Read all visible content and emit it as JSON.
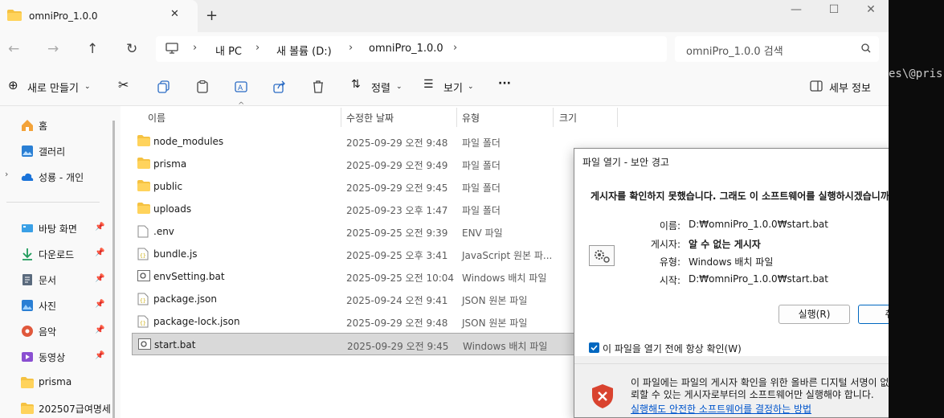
{
  "window": {
    "tab_title": "omniPro_1.0.0",
    "new_tab": "+",
    "close_tab": "✕",
    "minimize": "—",
    "maximize": "☐",
    "close": "✕"
  },
  "address": {
    "crumbs": [
      "내 PC",
      "새 볼륨 (D:)",
      "omniPro_1.0.0"
    ],
    "search_placeholder": "omniPro_1.0.0 검색"
  },
  "toolbar": {
    "new_label": "새로 만들기",
    "sort_label": "정렬",
    "view_label": "보기",
    "more_label": "···",
    "details_label": "세부 정보"
  },
  "sidebar": {
    "items": [
      {
        "label": "홈",
        "icon": "home-icon"
      },
      {
        "label": "갤러리",
        "icon": "gallery-icon"
      },
      {
        "label": "성룡 - 개인",
        "icon": "cloud-icon"
      },
      {
        "label": "바탕 화면",
        "icon": "desktop-icon",
        "pinned": true
      },
      {
        "label": "다운로드",
        "icon": "download-icon",
        "pinned": true
      },
      {
        "label": "문서",
        "icon": "document-icon",
        "pinned": true
      },
      {
        "label": "사진",
        "icon": "picture-icon",
        "pinned": true
      },
      {
        "label": "음악",
        "icon": "music-icon",
        "pinned": true
      },
      {
        "label": "동영상",
        "icon": "video-icon",
        "pinned": true
      },
      {
        "label": "prisma",
        "icon": "folder-icon"
      },
      {
        "label": "202507급여명세",
        "icon": "folder-icon"
      }
    ]
  },
  "columns": {
    "name": "이름",
    "modified": "수정한 날짜",
    "type": "유형",
    "size": "크기"
  },
  "files": [
    {
      "name": "node_modules",
      "date": "2025-09-29 오전 9:48",
      "type": "파일 폴더",
      "kind": "folder"
    },
    {
      "name": "prisma",
      "date": "2025-09-29 오전 9:49",
      "type": "파일 폴더",
      "kind": "folder"
    },
    {
      "name": "public",
      "date": "2025-09-29 오전 9:45",
      "type": "파일 폴더",
      "kind": "folder"
    },
    {
      "name": "uploads",
      "date": "2025-09-23 오후 1:47",
      "type": "파일 폴더",
      "kind": "folder"
    },
    {
      "name": ".env",
      "date": "2025-09-25 오전 9:39",
      "type": "ENV 파일",
      "kind": "file"
    },
    {
      "name": "bundle.js",
      "date": "2025-09-25 오후 3:41",
      "type": "JavaScript 원본 파...",
      "kind": "js"
    },
    {
      "name": "envSetting.bat",
      "date": "2025-09-25 오전 10:04",
      "type": "Windows 배치 파일",
      "kind": "bat"
    },
    {
      "name": "package.json",
      "date": "2025-09-24 오전 9:41",
      "type": "JSON 원본 파일",
      "kind": "json"
    },
    {
      "name": "package-lock.json",
      "date": "2025-09-29 오전 9:48",
      "type": "JSON 원본 파일",
      "kind": "json"
    },
    {
      "name": "start.bat",
      "date": "2025-09-29 오전 9:45",
      "type": "Windows 배치 파일",
      "kind": "bat",
      "selected": true
    }
  ],
  "dialog": {
    "title": "파일 열기 - 보안 경고",
    "question": "게시자를 확인하지 못했습니다.  그래도 이 소프트웨어를 실행하시겠습니까?",
    "name_key": "이름:",
    "name_val": "D:₩omniPro_1.0.0₩start.bat",
    "publisher_key": "게시자:",
    "publisher_val": "알 수 없는 게시자",
    "type_key": "유형:",
    "type_val": "Windows 배치 파일",
    "from_key": "시작:",
    "from_val": "D:₩omniPro_1.0.0₩start.bat",
    "run_button": "실행(R)",
    "cancel_button": "취소",
    "always_check": "이 파일을 열기 전에 항상 확인(W)",
    "warning_text": "이 파일에는 파일의 게시자 확인을 위한 올바른 디지털 서명이 없습니다.  신뢰할 수 있는 게시자로부터의 소프트웨어만 실행해야 합니다.",
    "warning_link": "실행해도 안전한 소프트웨어를 결정하는 방법"
  },
  "terminal": {
    "text": "es\\@pris"
  }
}
